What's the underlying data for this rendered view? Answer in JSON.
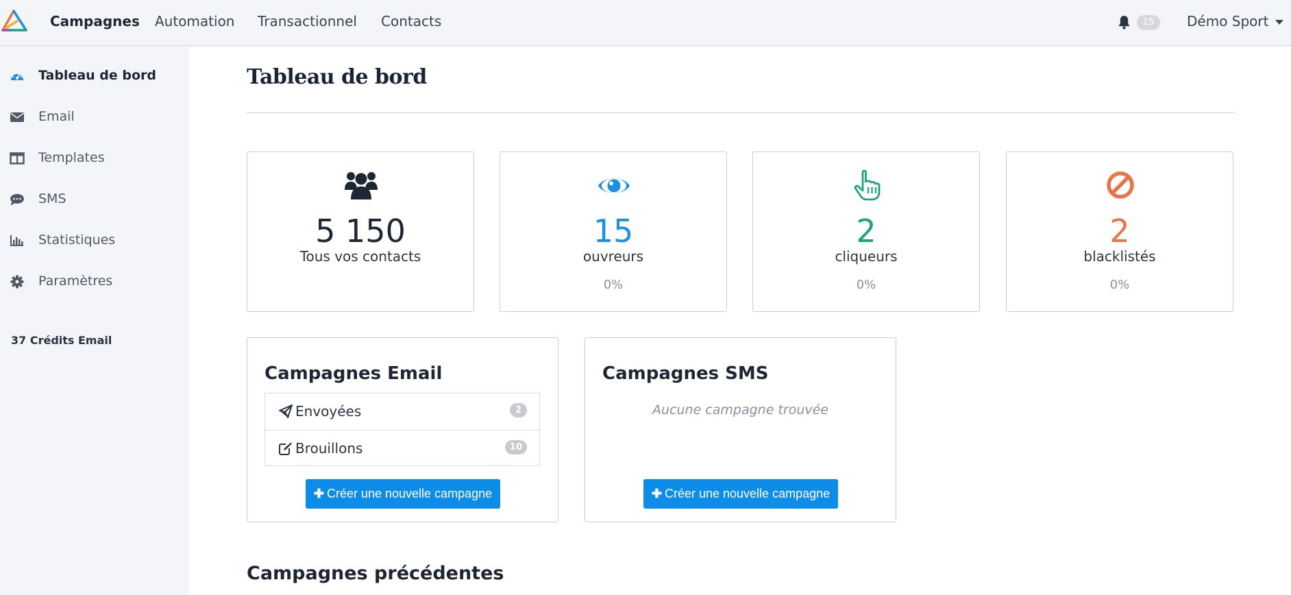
{
  "navbar": {
    "items": [
      {
        "label": "Campagnes",
        "active": true
      },
      {
        "label": "Automation"
      },
      {
        "label": "Transactionnel"
      },
      {
        "label": "Contacts"
      }
    ],
    "notifications_count": "15",
    "account_name": "Démo Sport"
  },
  "sidebar": {
    "items": [
      {
        "label": "Tableau de bord",
        "icon": "dashboard-icon",
        "active": true
      },
      {
        "label": "Email",
        "icon": "envelope-icon"
      },
      {
        "label": "Templates",
        "icon": "columns-icon"
      },
      {
        "label": "SMS",
        "icon": "comment-icon"
      },
      {
        "label": "Statistiques",
        "icon": "bar-chart-icon"
      },
      {
        "label": "Paramètres",
        "icon": "gear-icon"
      }
    ],
    "credits": "37 Crédits Email"
  },
  "page": {
    "title": "Tableau de bord"
  },
  "stats": [
    {
      "value": "5 150",
      "label": "Tous vos contacts",
      "icon": "users-icon",
      "color": "#1f2633"
    },
    {
      "value": "15",
      "label": "ouvreurs",
      "pct": "0%",
      "icon": "eye-icon",
      "color": "#1b8fe0"
    },
    {
      "value": "2",
      "label": "cliqueurs",
      "pct": "0%",
      "icon": "pointer-hand-icon",
      "color": "#1aa57f"
    },
    {
      "value": "2",
      "label": "blacklistés",
      "pct": "0%",
      "icon": "ban-icon",
      "color": "#e8744a"
    }
  ],
  "email_campaigns": {
    "title": "Campagnes Email",
    "rows": [
      {
        "label": "Envoyées",
        "count": "2",
        "icon": "paper-plane-icon"
      },
      {
        "label": "Brouillons",
        "count": "10",
        "icon": "edit-icon"
      }
    ],
    "button_label": "Créer une nouvelle campagne"
  },
  "sms_campaigns": {
    "title": "Campagnes SMS",
    "empty_message": "Aucune campagne trouvée",
    "button_label": "Créer une nouvelle campagne"
  },
  "previous": {
    "title": "Campagnes précédentes"
  }
}
